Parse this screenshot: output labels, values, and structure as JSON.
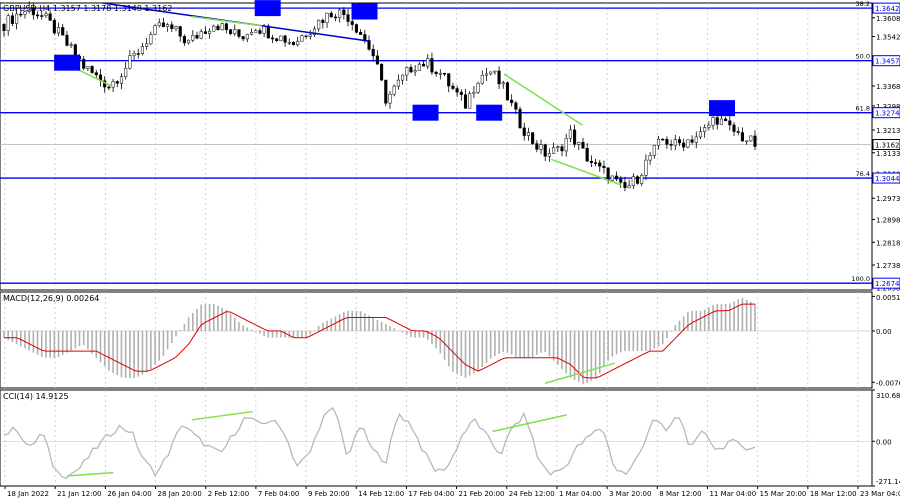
{
  "symbol_info": "GBPUSD,H4 1.3157 1.3178 1.3148 1.3162",
  "chart_data": [
    {
      "type": "candlestick",
      "panel": "price",
      "price_axis": {
        "ticks": [
          "1.3608",
          "1.3542",
          "1.3457",
          "1.3368",
          "1.3298",
          "1.3213",
          "1.3133",
          "1.3060",
          "1.2973",
          "1.2898",
          "1.2818",
          "1.2738",
          "1.2658"
        ],
        "range": [
          1.265,
          1.366
        ]
      },
      "price_tags": [
        {
          "price": 1.3642,
          "label": "1.3642",
          "fib": "38.2",
          "color": "#0000ff"
        },
        {
          "price": 1.3457,
          "label": "1.3457",
          "fib": "50.0",
          "color": "#0000ff"
        },
        {
          "price": 1.3274,
          "label": "1.3274",
          "fib": "61.8",
          "color": "#0000ff"
        },
        {
          "price": 1.3044,
          "label": "1.3044",
          "fib": "76.4",
          "color": "#0000ff"
        },
        {
          "price": 1.2674,
          "label": "1.2674",
          "fib": "100.0",
          "color": "#0000ff"
        },
        {
          "price": 1.3162,
          "label": "1.3162",
          "fib": "",
          "color": "#000000"
        }
      ],
      "close_path": [
        1.3585,
        1.362,
        1.364,
        1.361,
        1.356,
        1.35,
        1.344,
        1.34,
        1.337,
        1.342,
        1.348,
        1.354,
        1.358,
        1.356,
        1.352,
        1.356,
        1.359,
        1.356,
        1.354,
        1.358,
        1.356,
        1.354,
        1.352,
        1.356,
        1.36,
        1.363,
        1.362,
        1.356,
        1.348,
        1.332,
        1.338,
        1.344,
        1.345,
        1.342,
        1.336,
        1.33,
        1.34,
        1.342,
        1.335,
        1.325,
        1.318,
        1.313,
        1.314,
        1.32,
        1.313,
        1.308,
        1.305,
        1.3,
        1.304,
        1.312,
        1.318,
        1.316,
        1.318,
        1.32,
        1.326,
        1.322,
        1.319,
        1.3162
      ],
      "blue_boxes": [
        {
          "x": 0.077,
          "price": 1.345
        },
        {
          "x": 0.307,
          "price": 1.3642
        },
        {
          "x": 0.418,
          "price": 1.363
        },
        {
          "x": 0.488,
          "price": 1.3274
        },
        {
          "x": 0.561,
          "price": 1.3274
        },
        {
          "x": 0.828,
          "price": 1.329
        }
      ],
      "trend_lines": [
        {
          "color": "#0000cc",
          "from": {
            "x": 0.118,
            "price": 1.366
          },
          "to": {
            "x": 0.425,
            "price": 1.3525
          }
        },
        {
          "color": "#7fe04a",
          "from": {
            "x": 0.08,
            "price": 1.344
          },
          "to": {
            "x": 0.13,
            "price": 1.3365
          }
        },
        {
          "color": "#7fe04a",
          "from": {
            "x": 0.22,
            "price": 1.3612
          },
          "to": {
            "x": 0.3,
            "price": 1.358
          }
        },
        {
          "color": "#7fe04a",
          "from": {
            "x": 0.578,
            "price": 1.341
          },
          "to": {
            "x": 0.668,
            "price": 1.323
          }
        },
        {
          "color": "#7fe04a",
          "from": {
            "x": 0.632,
            "price": 1.311
          },
          "to": {
            "x": 0.712,
            "price": 1.302
          }
        }
      ]
    },
    {
      "type": "bar",
      "panel": "macd",
      "title": "MACD(12,26,9) 0.00264",
      "ticks": [
        "0.00515",
        "0.00",
        "-0.00765"
      ],
      "range": [
        -0.0085,
        0.0058
      ],
      "values": [
        -0.001,
        -0.002,
        -0.003,
        -0.004,
        -0.004,
        -0.003,
        -0.002,
        -0.004,
        -0.006,
        -0.007,
        -0.007,
        -0.006,
        -0.004,
        -0.001,
        0.002,
        0.004,
        0.004,
        0.003,
        0.001,
        0.0,
        -0.001,
        -0.001,
        -0.001,
        -0.001,
        0.001,
        0.002,
        0.003,
        0.003,
        0.002,
        0.001,
        0.0,
        -0.001,
        -0.001,
        -0.003,
        -0.006,
        -0.007,
        -0.006,
        -0.004,
        -0.003,
        -0.004,
        -0.004,
        -0.003,
        -0.005,
        -0.007,
        -0.008,
        -0.007,
        -0.004,
        -0.003,
        -0.003,
        -0.003,
        -0.002,
        0.001,
        0.003,
        0.003,
        0.004,
        0.004,
        0.005,
        0.004
      ],
      "signal": [
        -0.001,
        -0.001,
        -0.002,
        -0.003,
        -0.003,
        -0.003,
        -0.003,
        -0.003,
        -0.004,
        -0.005,
        -0.006,
        -0.006,
        -0.005,
        -0.004,
        -0.002,
        0.001,
        0.002,
        0.003,
        0.002,
        0.001,
        0.0,
        0.0,
        -0.001,
        -0.001,
        0.0,
        0.001,
        0.002,
        0.002,
        0.002,
        0.002,
        0.001,
        0.0,
        0.0,
        -0.001,
        -0.003,
        -0.005,
        -0.006,
        -0.005,
        -0.004,
        -0.004,
        -0.004,
        -0.004,
        -0.004,
        -0.005,
        -0.007,
        -0.007,
        -0.006,
        -0.005,
        -0.004,
        -0.003,
        -0.003,
        -0.001,
        0.001,
        0.002,
        0.003,
        0.003,
        0.004,
        0.004
      ],
      "divergence": {
        "color": "#7fe04a",
        "from": {
          "x": 0.625,
          "value": -0.0078
        },
        "to": {
          "x": 0.705,
          "value": -0.0048
        }
      }
    },
    {
      "type": "line",
      "panel": "cci",
      "title": "CCI(14) 14.9125",
      "ticks": [
        "310.6865",
        "0.00",
        "-271.1415"
      ],
      "range": [
        -271.1415,
        310.6865
      ],
      "values": [
        40,
        80,
        -50,
        60,
        -180,
        -210,
        -160,
        -60,
        20,
        90,
        60,
        -120,
        -200,
        -60,
        110,
        30,
        -30,
        -80,
        40,
        150,
        100,
        130,
        60,
        -150,
        -80,
        140,
        200,
        -100,
        100,
        -60,
        -120,
        170,
        100,
        -70,
        -190,
        -140,
        40,
        130,
        20,
        -80,
        90,
        160,
        -120,
        -200,
        -160,
        -40,
        30,
        90,
        -170,
        -200,
        -60,
        140,
        60,
        160,
        -50,
        70,
        -60,
        0,
        -30,
        -40
      ],
      "divergences": [
        {
          "color": "#7fe04a",
          "from": {
            "x": 0.077,
            "value": -210
          },
          "to": {
            "x": 0.13,
            "value": -190
          }
        },
        {
          "color": "#7fe04a",
          "from": {
            "x": 0.22,
            "value": 130
          },
          "to": {
            "x": 0.29,
            "value": 180
          }
        },
        {
          "color": "#7fe04a",
          "from": {
            "x": 0.565,
            "value": 60
          },
          "to": {
            "x": 0.65,
            "value": 160
          }
        }
      ]
    }
  ],
  "time_axis": [
    "18 Jan 2022",
    "21 Jan 12:00",
    "26 Jan 04:00",
    "28 Jan 20:00",
    "2 Feb 12:00",
    "7 Feb 04:00",
    "9 Feb 20:00",
    "14 Feb 12:00",
    "17 Feb 04:00",
    "21 Feb 20:00",
    "24 Feb 12:00",
    "1 Mar 04:00",
    "3 Mar 20:00",
    "8 Mar 12:00",
    "11 Mar 04:00",
    "15 Mar 20:00",
    "18 Mar 12:00",
    "23 Mar 04:00"
  ],
  "colors": {
    "fib_line": "#0000ff",
    "candles": "#000000",
    "grid": "#c8c8c8",
    "histogram": "#b0b0b0",
    "signal": "#e00000",
    "cci": "#b8b8b8",
    "divergence": "#7fe04a",
    "trend": "#0000cc"
  }
}
